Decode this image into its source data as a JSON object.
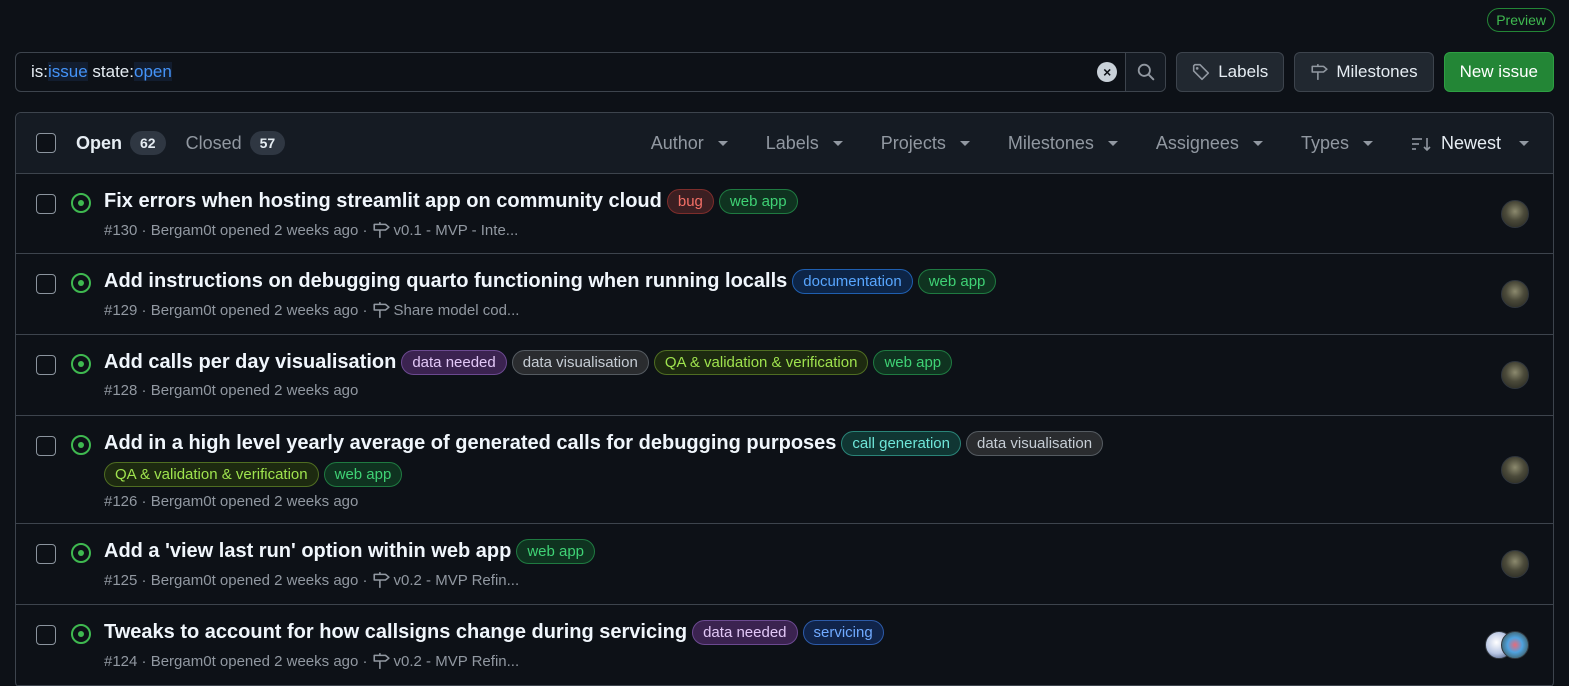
{
  "preview_badge": "Preview",
  "search": {
    "qualifier_1": "is:",
    "value_1": "issue",
    "qualifier_2": " state:",
    "value_2": "open"
  },
  "toolbar": {
    "labels_label": "Labels",
    "milestones_label": "Milestones",
    "new_issue_label": "New issue"
  },
  "header": {
    "open_label": "Open",
    "open_count": "62",
    "closed_label": "Closed",
    "closed_count": "57",
    "filters": [
      "Author",
      "Labels",
      "Projects",
      "Milestones",
      "Assignees",
      "Types"
    ],
    "sort_label": "Newest"
  },
  "label_colors": {
    "bug": {
      "fg": "#f47067",
      "bg": "#3c1f22",
      "border": "#7d2d2b"
    },
    "web app": {
      "fg": "#3fd275",
      "bg": "#0f3320",
      "border": "#1f7a41"
    },
    "documentation": {
      "fg": "#58a6ff",
      "bg": "#0d2547",
      "border": "#1f5fb0"
    },
    "data needed": {
      "fg": "#e2c8f7",
      "bg": "#3b2350",
      "border": "#6b4990"
    },
    "data visualisation": {
      "fg": "#c6cdd5",
      "bg": "#2a2c2f",
      "border": "#555b61"
    },
    "QA & validation & verification": {
      "fg": "#9fe34e",
      "bg": "#1d2a10",
      "border": "#4f6d22"
    },
    "call generation": {
      "fg": "#6fe6d9",
      "bg": "#103633",
      "border": "#2a8478"
    },
    "servicing": {
      "fg": "#70aaff",
      "bg": "#10244a",
      "border": "#2c5aa8"
    }
  },
  "issues": [
    {
      "title": "Fix errors when hosting streamlit app on community cloud",
      "labels": [
        "bug",
        "web app"
      ],
      "meta": "#130 · Bergam0t opened 2 weeks ago ·",
      "milestone": "v0.1 - MVP - Inte..."
    },
    {
      "title": "Add instructions on debugging quarto functioning when running localls",
      "labels": [
        "documentation",
        "web app"
      ],
      "meta": "#129 · Bergam0t opened 2 weeks ago ·",
      "milestone": "Share model cod..."
    },
    {
      "title": "Add calls per day visualisation",
      "labels": [
        "data needed",
        "data visualisation",
        "QA & validation & verification",
        "web app"
      ],
      "meta": "#128 · Bergam0t opened 2 weeks ago",
      "milestone": ""
    },
    {
      "title": "Add in a high level yearly average of generated calls for debugging purposes",
      "labels": [
        "call generation",
        "data visualisation",
        "QA & validation & verification",
        "web app"
      ],
      "meta": "#126 · Bergam0t opened 2 weeks ago",
      "milestone": ""
    },
    {
      "title": "Add a 'view last run' option within web app",
      "labels": [
        "web app"
      ],
      "meta": "#125 · Bergam0t opened 2 weeks ago ·",
      "milestone": "v0.2 - MVP Refin..."
    },
    {
      "title": "Tweaks to account for how callsigns change during servicing",
      "labels": [
        "data needed",
        "servicing"
      ],
      "meta": "#124 · Bergam0t opened 2 weeks ago ·",
      "milestone": "v0.2 - MVP Refin..."
    }
  ]
}
